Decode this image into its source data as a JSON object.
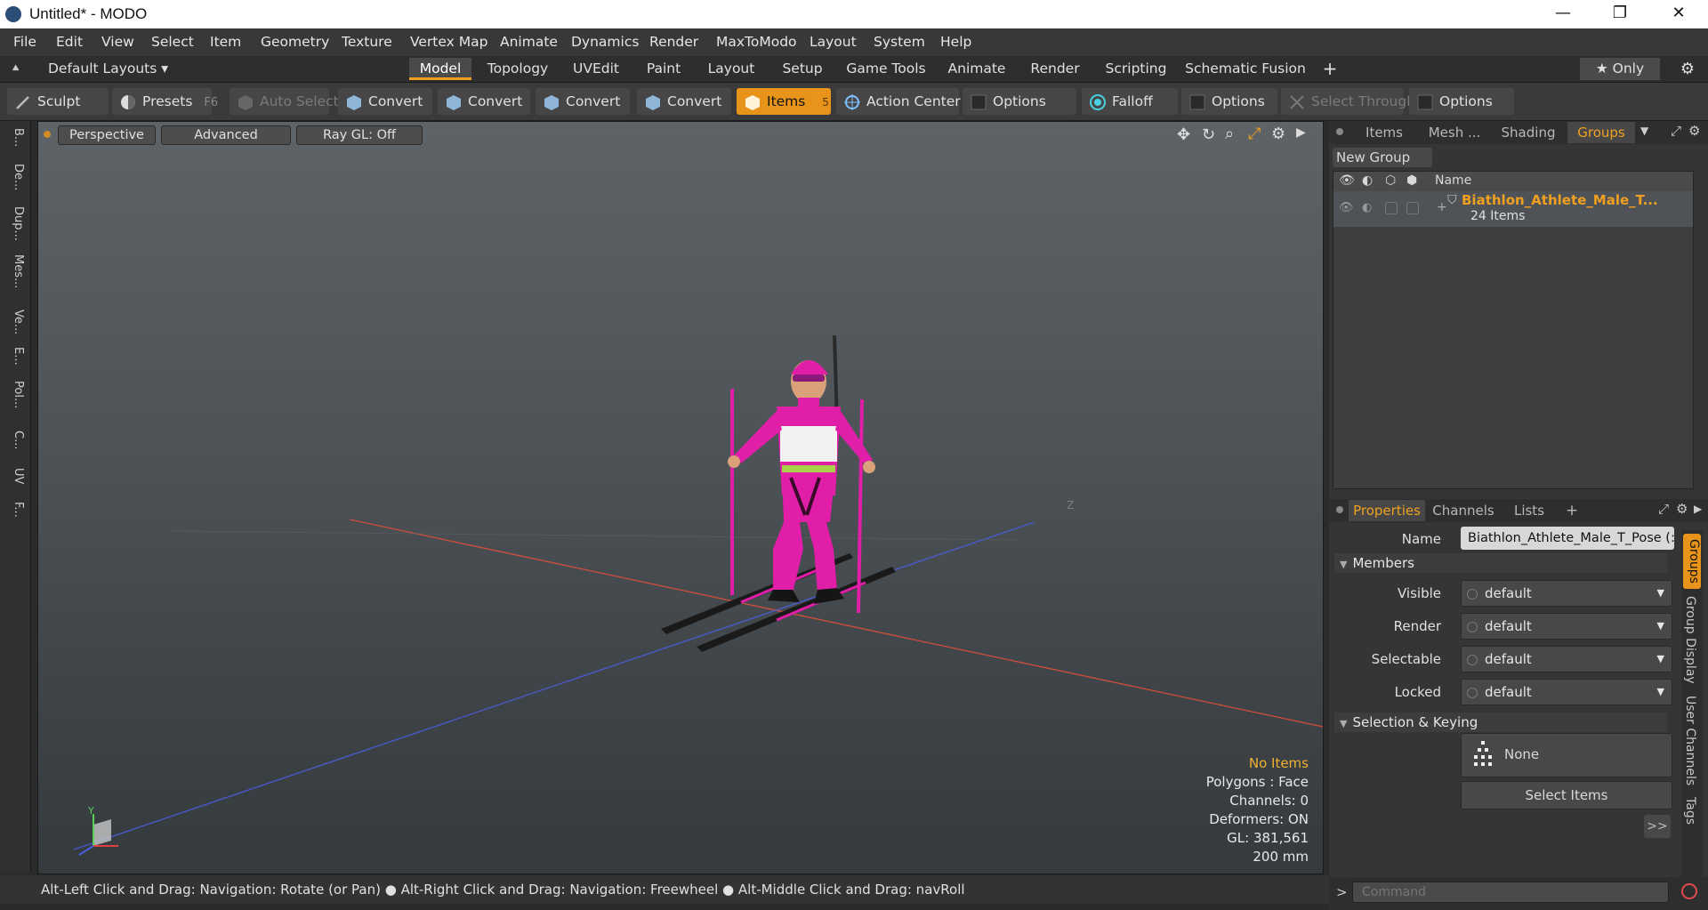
{
  "window": {
    "title": "Untitled* - MODO",
    "min": "—",
    "max": "❐",
    "close": "✕"
  },
  "menu": [
    "File",
    "Edit",
    "View",
    "Select",
    "Item",
    "Geometry",
    "Texture",
    "Vertex Map",
    "Animate",
    "Dynamics",
    "Render",
    "MaxToModo",
    "Layout",
    "System",
    "Help"
  ],
  "layouts": {
    "selector": "Default Layouts ▾",
    "tabs": [
      "Model",
      "Topology",
      "UVEdit",
      "Paint",
      "Layout",
      "Setup",
      "Game Tools",
      "Animate",
      "Render",
      "Scripting",
      "Schematic Fusion"
    ],
    "active": "Model",
    "add": "+",
    "only": "★  Only"
  },
  "toolbar": {
    "sculpt": "Sculpt",
    "presets": "Presets",
    "presets_key": "F6",
    "auto_select": "Auto Select",
    "convert": "Convert",
    "items": "Items",
    "items_key": "5",
    "action_center": "Action Center",
    "options": "Options",
    "falloff": "Falloff",
    "select_through": "Select Through"
  },
  "left_strip": [
    "B...",
    "De...",
    "Dup...",
    "Mes...",
    "Ve...",
    "E...",
    "Pol...",
    "C...",
    "UV",
    "F..."
  ],
  "viewport": {
    "view_mode": "Perspective",
    "shading": "Advanced",
    "raygl": "Ray GL: Off",
    "info": {
      "items": "No Items",
      "polygons": "Polygons : Face",
      "channels": "Channels: 0",
      "deformers": "Deformers: ON",
      "gl": "GL: 381,561",
      "scale": "200 mm"
    },
    "axis_y": "Y",
    "axis_z": "Z"
  },
  "status": "Alt-Left Click and Drag: Navigation: Rotate (or Pan) ● Alt-Right Click and Drag: Navigation: Freewheel ● Alt-Middle Click and Drag: navRoll",
  "groups_panel": {
    "tabs": [
      "Items",
      "Mesh ...",
      "Shading",
      "Groups"
    ],
    "active": "Groups",
    "new_group": "New Group",
    "col_name": "Name",
    "row_name": "Biathlon_Athlete_Male_T...",
    "row_count": "24 Items"
  },
  "properties": {
    "tabs": [
      "Properties",
      "Channels",
      "Lists"
    ],
    "active": "Properties",
    "add": "+",
    "name_label": "Name",
    "name_value": "Biathlon_Athlete_Male_T_Pose (:",
    "members": "Members",
    "fields": [
      {
        "label": "Visible",
        "value": "default"
      },
      {
        "label": "Render",
        "value": "default"
      },
      {
        "label": "Selectable",
        "value": "default"
      },
      {
        "label": "Locked",
        "value": "default"
      }
    ],
    "selection_keying": "Selection & Keying",
    "none": "None",
    "select_items": "Select Items",
    "more": ">>",
    "side_tabs": [
      "Groups",
      "Group Display",
      "User Channels",
      "Tags"
    ]
  },
  "command": {
    "placeholder": "Command",
    "prompt": ">"
  },
  "colors": {
    "accent": "#f0a020",
    "suit": "#e01ea8"
  }
}
